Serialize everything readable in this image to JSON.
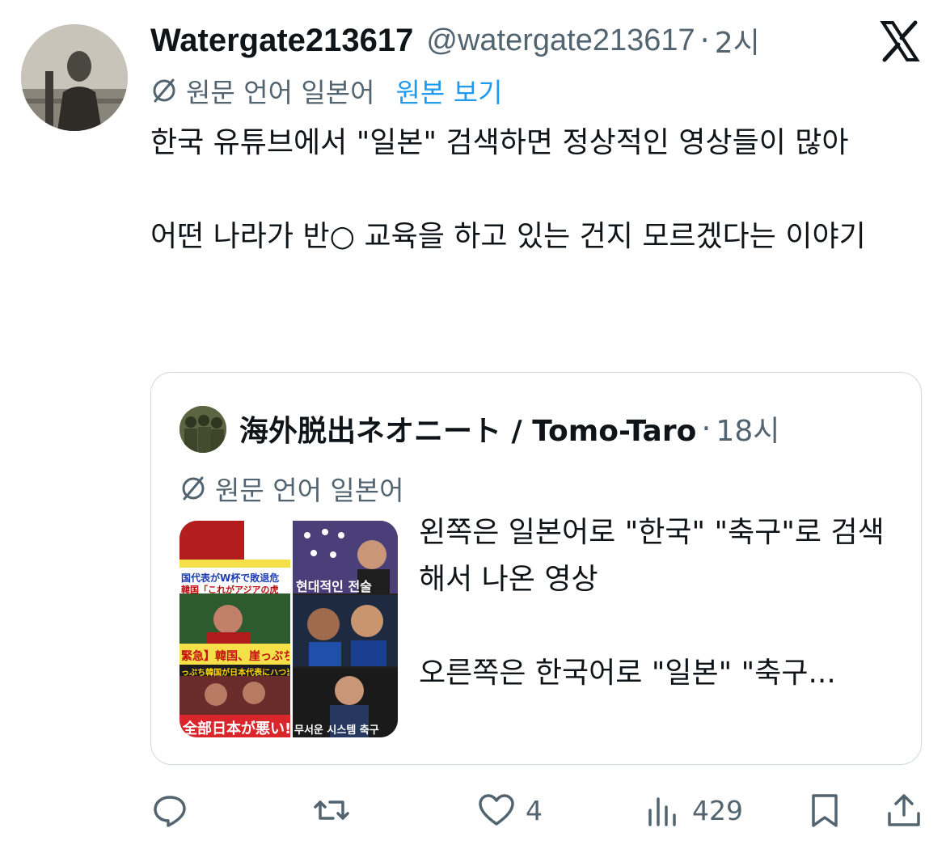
{
  "tweet": {
    "display_name": "Watergate213617",
    "handle": "@watergate213617",
    "separator": "·",
    "time": "2시",
    "lang_label": "원문 언어 일본어",
    "show_original": "원본 보기",
    "text": "한국 유튜브에서 \"일본\" 검색하면 정상적인 영상들이 많아\n\n어떤 나라가 반○ 교육을 하고 있는 건지 모르겠다는 이야기"
  },
  "quote": {
    "display_name": "海外脱出ネオニート / Tomo-Taro",
    "separator": "·",
    "time": "18시",
    "lang_label": "원문 언어 일본어",
    "text": "왼쪽은 일본어로 \"한국\" \"축구\"로 검색해서 나온 영상\n\n오른쪽은 한국어로 \"일본\" \"축구...",
    "thumbnail_text": {
      "left_banner_1": "国代表がW杯で敗退危",
      "left_banner_2": "韓国「これがアジアの虎",
      "left_banner_3": "緊急】韓国、崖っぷち",
      "left_banner_4": "っぷち韓国が日本代表にハつ当た",
      "left_banner_5": "全部日本が悪い!",
      "right_caption_1": "현대적인 전술",
      "right_caption_2": "무서운 시스템 축구"
    }
  },
  "actions": {
    "reply_count": "",
    "retweet_count": "",
    "like_count": "4",
    "views_count": "429"
  },
  "colors": {
    "text_primary": "#0f1419",
    "text_secondary": "#536471",
    "link_blue": "#1d9bf0",
    "border": "#cfd9de"
  },
  "icons": [
    "translate-globe-icon",
    "x-logo-icon",
    "reply-icon",
    "retweet-icon",
    "like-icon",
    "views-icon",
    "bookmark-icon",
    "share-icon"
  ]
}
